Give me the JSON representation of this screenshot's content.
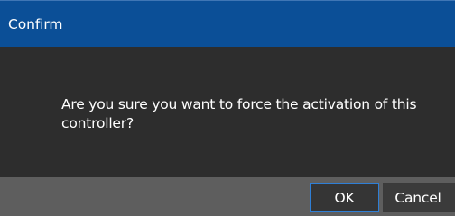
{
  "dialog": {
    "title": "Confirm",
    "message": "Are you sure you want to force the activation of this controller?",
    "buttons": {
      "ok_label": "OK",
      "cancel_label": "Cancel"
    }
  },
  "colors": {
    "title_bar": "#0b4f97",
    "content_bg": "#2d2d2d",
    "footer_bg": "#5e5e5e",
    "button_bg": "#3a3a3a",
    "focus_border": "#2f7fd6",
    "text": "#ffffff"
  }
}
